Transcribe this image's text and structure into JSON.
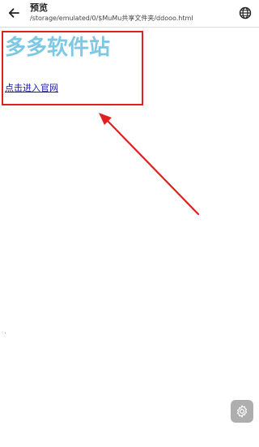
{
  "header": {
    "title": "预览",
    "path": "/storage/emulated/0/$MuMu共享文件夹/ddooo.html",
    "back_icon": "back-arrow-icon",
    "globe_icon": "globe-icon"
  },
  "page": {
    "heading": "多多软件站",
    "link_text": "点击进入官网",
    "heading_color": "#7ec8e3",
    "link_color": "#1a1aa6"
  },
  "annotation": {
    "highlight_color": "#e02020"
  },
  "floating": {
    "settings_icon": "gear-icon"
  }
}
